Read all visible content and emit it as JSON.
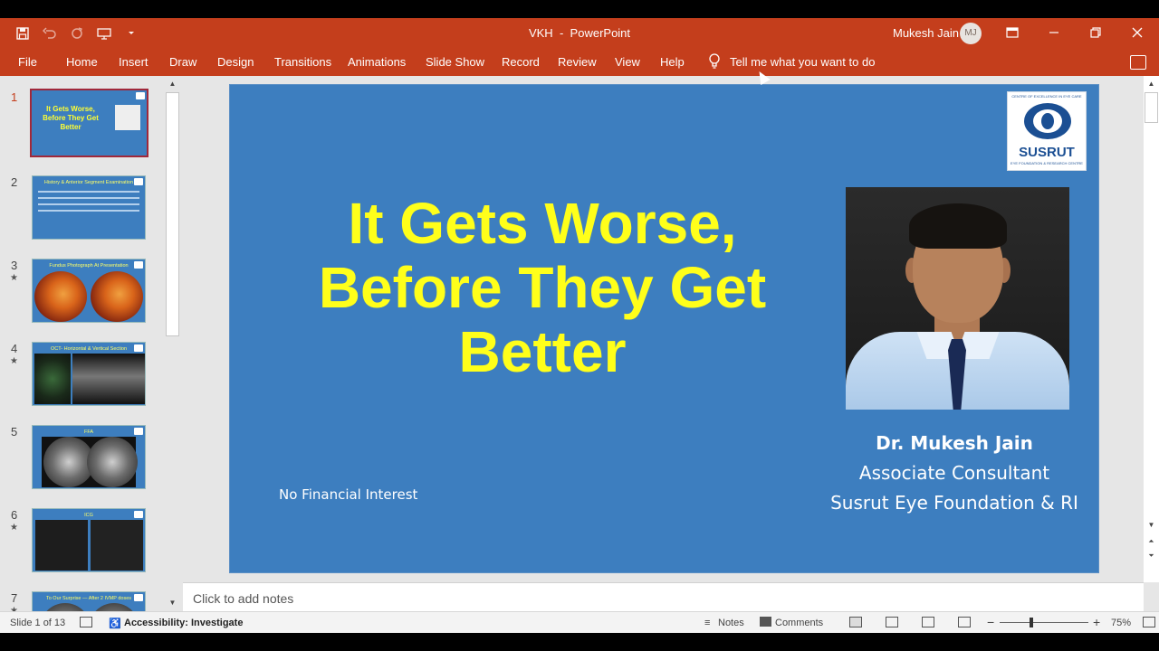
{
  "window": {
    "doc_name": "VKH",
    "separator": "-",
    "app_name": "PowerPoint",
    "user_name": "Mukesh Jain",
    "user_initials": "MJ"
  },
  "ribbon": {
    "tabs": [
      "File",
      "Home",
      "Insert",
      "Draw",
      "Design",
      "Transitions",
      "Animations",
      "Slide Show",
      "Record",
      "Review",
      "View",
      "Help"
    ],
    "tell_me": "Tell me what you want to do"
  },
  "thumbnails": [
    {
      "num": "1",
      "star": "",
      "title": "It Gets Worse, Before They Get Better"
    },
    {
      "num": "2",
      "star": "",
      "title": "History & Anterior Segment Examination"
    },
    {
      "num": "3",
      "star": "★",
      "title": "Fundus Photograph At Presentation"
    },
    {
      "num": "4",
      "star": "★",
      "title": "OCT- Horizontal & Vertical Section"
    },
    {
      "num": "5",
      "star": "",
      "title": "FFA"
    },
    {
      "num": "6",
      "star": "★",
      "title": "ICG"
    },
    {
      "num": "7",
      "star": "★",
      "title": "To Our Surprise — After 2 IVMP doses"
    }
  ],
  "slide": {
    "title": "It Gets Worse,\nBefore They Get\nBetter",
    "logo_brand": "SUSRUT",
    "logo_arc": "CENTRE OF EXCELLENCE IN EYE CARE",
    "logo_sub": "EYE FOUNDATION & RESEARCH CENTRE",
    "presenter_name": "Dr. Mukesh Jain",
    "presenter_role": "Associate Consultant",
    "presenter_org": "Susrut Eye Foundation & RI",
    "disclosure": "No Financial Interest"
  },
  "notes": {
    "placeholder": "Click to add notes"
  },
  "status": {
    "slide_info": "Slide 1 of 13",
    "accessibility": "Accessibility: Investigate",
    "notes_label": "Notes",
    "comments_label": "Comments",
    "zoom": "75%",
    "zoom_minus": "−",
    "zoom_plus": "+"
  },
  "colors": {
    "ribbon": "#c43e1c",
    "slide_bg": "#3d7ebf",
    "title_yellow": "#ffff1a"
  }
}
